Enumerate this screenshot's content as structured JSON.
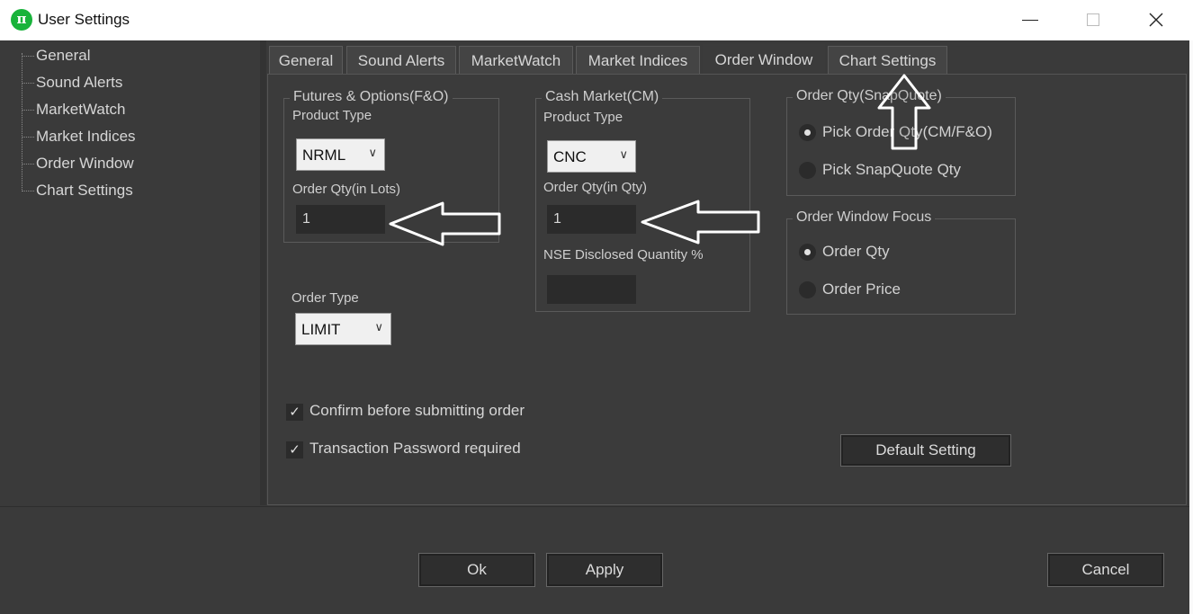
{
  "window": {
    "title": "User Settings",
    "icon_glyph": "π"
  },
  "sidebar": {
    "items": [
      {
        "label": "General"
      },
      {
        "label": "Sound Alerts"
      },
      {
        "label": "MarketWatch"
      },
      {
        "label": "Market Indices"
      },
      {
        "label": "Order Window"
      },
      {
        "label": "Chart Settings"
      }
    ]
  },
  "tabs": [
    {
      "label": "General",
      "active": false
    },
    {
      "label": "Sound Alerts",
      "active": false
    },
    {
      "label": "MarketWatch",
      "active": false
    },
    {
      "label": "Market Indices",
      "active": false
    },
    {
      "label": "Order Window",
      "active": true
    },
    {
      "label": "Chart Settings",
      "active": false
    }
  ],
  "fno": {
    "title": "Futures & Options(F&O)",
    "product_type_label": "Product Type",
    "product_type_value": "NRML",
    "order_qty_label": "Order Qty(in Lots)",
    "order_qty_value": "1",
    "order_type_label": "Order Type",
    "order_type_value": "LIMIT"
  },
  "cm": {
    "title": "Cash Market(CM)",
    "product_type_label": "Product Type",
    "product_type_value": "CNC",
    "order_qty_label": "Order Qty(in Qty)",
    "order_qty_value": "1",
    "disclosed_label": "NSE Disclosed Quantity  %",
    "disclosed_value": ""
  },
  "snapquote": {
    "title": "Order Qty(SnapQuote)",
    "options": [
      {
        "label": "Pick Order Qty(CM/F&O)",
        "selected": true
      },
      {
        "label": "Pick SnapQuote Qty",
        "selected": false
      }
    ]
  },
  "focus": {
    "title": "Order Window Focus",
    "options": [
      {
        "label": "Order Qty",
        "selected": true
      },
      {
        "label": "Order Price",
        "selected": false
      }
    ]
  },
  "checks": [
    {
      "label": "Confirm before submitting order",
      "checked": true
    },
    {
      "label": "Transaction Password required",
      "checked": true
    }
  ],
  "buttons": {
    "default_setting": "Default Setting",
    "ok": "Ok",
    "apply": "Apply",
    "cancel": "Cancel"
  },
  "colors": {
    "background": "#3a3a3a",
    "input_bg": "#2b2b2b",
    "accent_icon": "#19b33b"
  }
}
